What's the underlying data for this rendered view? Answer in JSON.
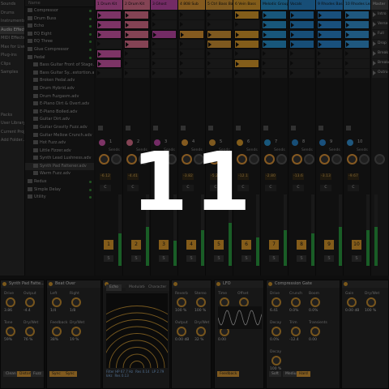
{
  "left_panel": {
    "categories": [
      {
        "label": "Sounds",
        "selected": false
      },
      {
        "label": "Drums",
        "selected": false
      },
      {
        "label": "Instruments",
        "selected": false
      },
      {
        "label": "Audio Effects",
        "selected": true
      },
      {
        "label": "MIDI Effects",
        "selected": false
      },
      {
        "label": "Max for Live",
        "selected": false
      },
      {
        "label": "Plug-ins",
        "selected": false
      },
      {
        "label": "Clips",
        "selected": false
      },
      {
        "label": "Samples",
        "selected": false
      },
      {
        "label": "",
        "selected": false
      },
      {
        "label": "",
        "selected": false
      },
      {
        "label": "",
        "selected": false
      },
      {
        "label": "",
        "selected": false
      },
      {
        "label": "Packs",
        "selected": false
      },
      {
        "label": "User Library",
        "selected": false
      },
      {
        "label": "Current Project",
        "selected": false
      },
      {
        "label": "Add Folder...",
        "selected": false
      }
    ]
  },
  "browser": {
    "header": "Name",
    "items": [
      {
        "label": "Compressor",
        "selected": false
      },
      {
        "label": "Drum Buss",
        "selected": false
      },
      {
        "label": "Echo",
        "selected": false
      },
      {
        "label": "EQ Eight",
        "selected": false
      },
      {
        "label": "EQ Three",
        "selected": false
      },
      {
        "label": "Glue Compressor",
        "selected": false
      },
      {
        "label": "Pedal",
        "selected": false
      },
      {
        "label": "Bass Guitar Front of Stage.adv",
        "selected": false
      },
      {
        "label": "Bass Guitar Sy...estortion.adv",
        "selected": false
      },
      {
        "label": "Broken Pedal.adv",
        "selected": false
      },
      {
        "label": "Drum Hybrid.adv",
        "selected": false
      },
      {
        "label": "Drum Fuzgasm.adv",
        "selected": false
      },
      {
        "label": "E-Piano Dirt & Overt.adv",
        "selected": false
      },
      {
        "label": "E-Piano Boiled.adv",
        "selected": false
      },
      {
        "label": "Guitar Dirt.adv",
        "selected": false
      },
      {
        "label": "Guitar Gravity Fuzz.adv",
        "selected": false
      },
      {
        "label": "Guitar Mellow Crunch.adv",
        "selected": false
      },
      {
        "label": "Hot Fuzz.adv",
        "selected": false
      },
      {
        "label": "Little Fizzer.adv",
        "selected": false
      },
      {
        "label": "Synth Lead Lushness.adv",
        "selected": false
      },
      {
        "label": "Synth Pad Fattener.adv",
        "selected": true
      },
      {
        "label": "Warm Fuzz.adv",
        "selected": false
      },
      {
        "label": "Redux",
        "selected": false
      },
      {
        "label": "Simple Delay",
        "selected": false
      },
      {
        "label": "Utility",
        "selected": false
      }
    ]
  },
  "tracks": [
    {
      "name": "1 Drum Kit",
      "color": "#e35fba",
      "number": "1",
      "vol": "-6.12",
      "pan": "C",
      "meter": 0.45,
      "slots": [
        true,
        true,
        true,
        false,
        true,
        true,
        false
      ]
    },
    {
      "name": "2 Drum Kit",
      "color": "#f07a9a",
      "number": "2",
      "vol": "-4.41",
      "pan": "C",
      "meter": 0.55,
      "slots": [
        true,
        true,
        true,
        true,
        false,
        false,
        false
      ]
    },
    {
      "name": "3 Ghost",
      "color": "#d14fb8",
      "number": "3",
      "vol": "-8.10",
      "pan": "C",
      "meter": 0.35,
      "slots": [
        false,
        false,
        true,
        false,
        false,
        false,
        false
      ]
    },
    {
      "name": "4 808 Sub",
      "color": "#f0a43a",
      "number": "4",
      "vol": "-3.82",
      "pan": "C",
      "meter": 0.5,
      "slots": [
        false,
        false,
        true,
        false,
        false,
        false,
        false
      ]
    },
    {
      "name": "5 Ctrl Bass Back",
      "color": "#e6a33a",
      "number": "5",
      "vol": "-5.20",
      "pan": "C",
      "meter": 0.6,
      "slots": [
        false,
        false,
        true,
        true,
        false,
        false,
        false
      ]
    },
    {
      "name": "6 Vein Bass",
      "color": "#efaa30",
      "number": "6",
      "vol": "-12.1",
      "pan": "C",
      "meter": 0.4,
      "slots": [
        true,
        false,
        true,
        true,
        false,
        true,
        false
      ]
    },
    {
      "name": "Melodic Group",
      "color": "#2d9fe0",
      "number": "7",
      "vol": "-2.80",
      "pan": "C",
      "meter": 0.5,
      "slots": [
        true,
        true,
        true,
        true,
        false,
        false,
        false
      ]
    },
    {
      "name": "Vocals",
      "color": "#2b8ed9",
      "number": "8",
      "vol": "-13.6",
      "pan": "C",
      "meter": 0.45,
      "slots": [
        true,
        true,
        true,
        true,
        false,
        false,
        false
      ]
    },
    {
      "name": "9 Rhodes Bass",
      "color": "#2f93e2",
      "number": "9",
      "vol": "-3.13",
      "pan": "C",
      "meter": 0.55,
      "slots": [
        true,
        true,
        true,
        true,
        false,
        false,
        false
      ]
    },
    {
      "name": "10 Rhodes Lead",
      "color": "#3aa0e8",
      "number": "10",
      "vol": "-9.67",
      "pan": "C",
      "meter": 0.5,
      "slots": [
        true,
        true,
        true,
        true,
        false,
        false,
        false
      ]
    }
  ],
  "master": {
    "name": "Master",
    "color": "#3a3a3a",
    "scenes": [
      "Intro",
      "Verse",
      "Full",
      "Drop",
      "Break",
      "Breakd",
      "Outro"
    ]
  },
  "send_labels": [
    "Sends",
    "Sends"
  ],
  "devices": [
    {
      "title": "Synth Pad Fatte...",
      "params": [
        {
          "label": "Drive",
          "value": "3.86"
        },
        {
          "label": "Output",
          "value": "-4.4"
        },
        {
          "label": "Tone",
          "value": "59%"
        },
        {
          "label": "Dry/Wet",
          "value": "76 %"
        }
      ],
      "buttons": [
        {
          "label": "Clean",
          "on": false
        },
        {
          "label": "Distort",
          "on": true
        },
        {
          "label": "Fuzz",
          "on": false
        }
      ]
    },
    {
      "title": "Beat Over",
      "params": [
        {
          "label": "Left",
          "value": "1/4"
        },
        {
          "label": "Right",
          "value": "1/8"
        },
        {
          "label": "Feedback",
          "value": "38%"
        },
        {
          "label": "Dry/Wet",
          "value": "19 %"
        }
      ],
      "buttons": [
        {
          "label": "Sync",
          "on": true
        },
        {
          "label": "Sync",
          "on": true
        }
      ]
    },
    {
      "title": "",
      "tabs": [
        {
          "label": "Echo",
          "selected": true
        },
        {
          "label": "Modulation",
          "selected": false
        },
        {
          "label": "Character",
          "selected": false
        }
      ],
      "footer": [
        "Filter HP 67.7 Hz",
        "Res 0.14",
        "LP 2.79 kHz",
        "Res 0.13"
      ]
    },
    {
      "title": "",
      "params": [
        {
          "label": "Reverb",
          "value": "100 %"
        },
        {
          "label": "Stereo",
          "value": "100 %"
        },
        {
          "label": "Output",
          "value": "0.00 dB"
        },
        {
          "label": "Dry/Wet",
          "value": "32 %"
        }
      ]
    },
    {
      "title": "LFO",
      "params": [
        {
          "label": "Time",
          "value": "1/8"
        },
        {
          "label": "Offset",
          "value": "0.0%"
        },
        {
          "label": "Phase",
          "value": "0.00"
        }
      ],
      "buttons": [
        {
          "label": "Feedback",
          "on": true
        }
      ]
    },
    {
      "title": "Compression Gate",
      "params": [
        {
          "label": "Drive",
          "value": "6.41"
        },
        {
          "label": "Crunch",
          "value": "0.0%"
        },
        {
          "label": "Boom",
          "value": "0.0%"
        },
        {
          "label": "Decay",
          "value": "0.0%"
        },
        {
          "label": "Trim",
          "value": "-12.4"
        },
        {
          "label": "Transients",
          "value": "0.00"
        },
        {
          "label": "Decay",
          "value": "100 %"
        }
      ],
      "buttons": [
        {
          "label": "Soft",
          "on": false
        },
        {
          "label": "Medium",
          "on": false
        },
        {
          "label": "Hard",
          "on": true
        }
      ]
    },
    {
      "title": "",
      "params": [
        {
          "label": "Gain",
          "value": "0.00 dB"
        },
        {
          "label": "Dry/Wet",
          "value": "100 %"
        }
      ]
    }
  ],
  "countdown": "11",
  "colors": {
    "accent": "#f0a830",
    "meter": "#2fa946",
    "overlay": "rgba(0,0,0,0.45)"
  }
}
